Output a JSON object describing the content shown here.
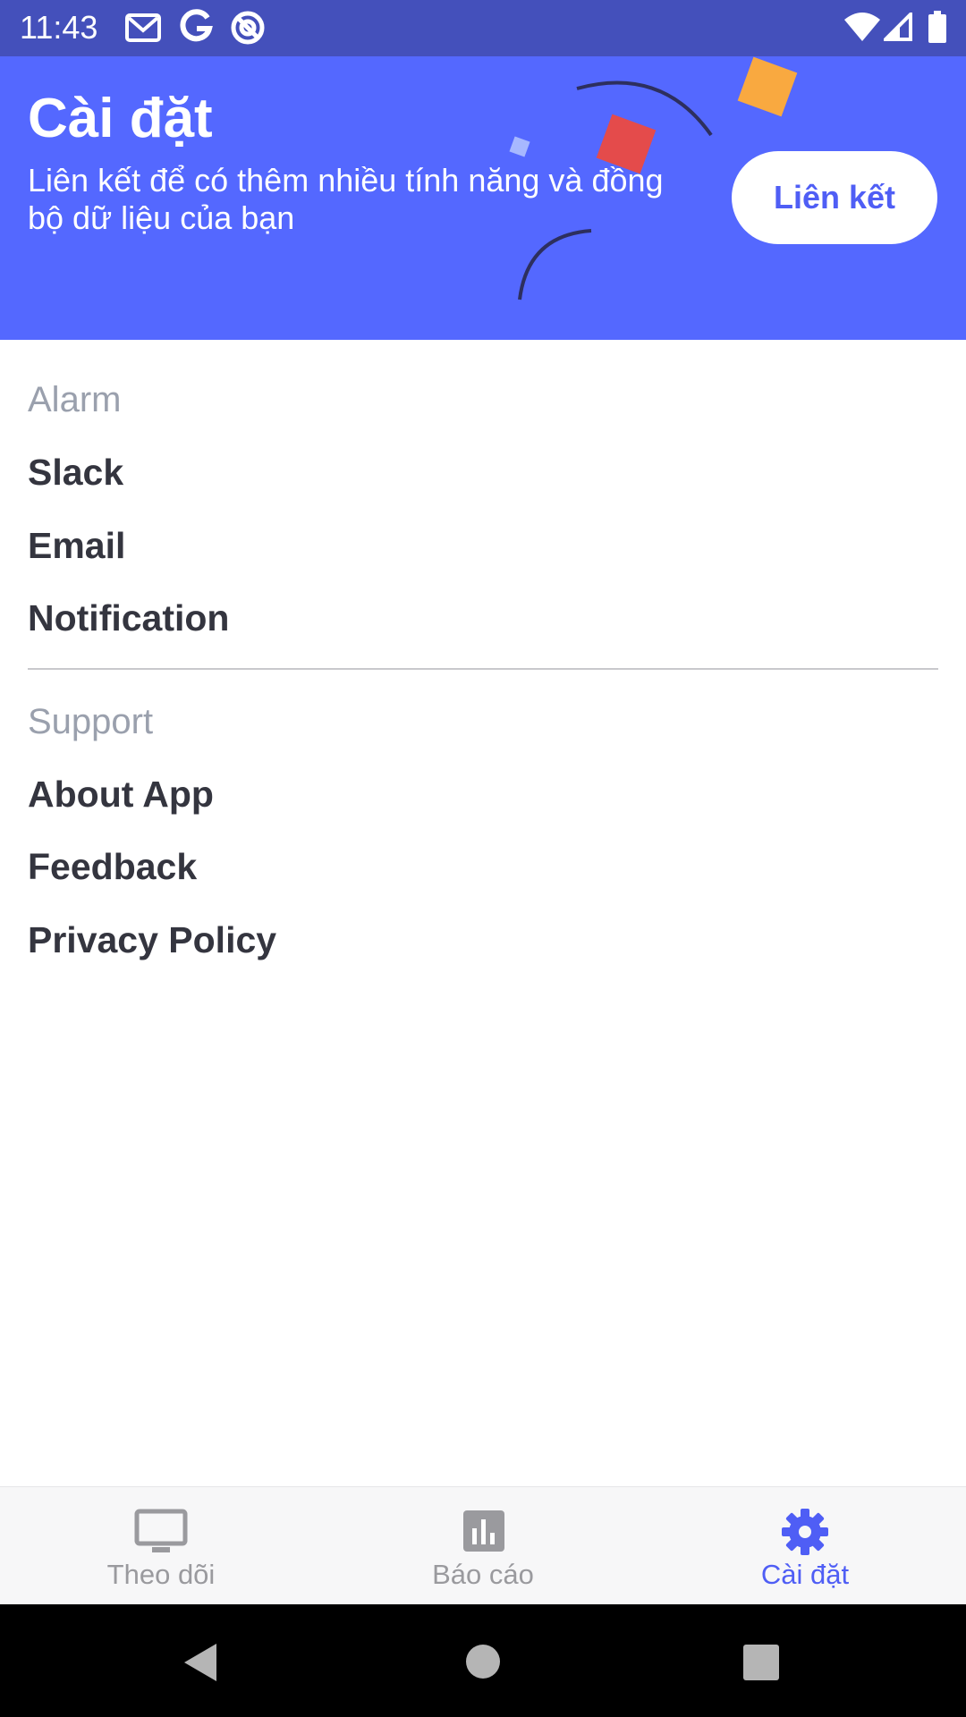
{
  "status_bar": {
    "time": "11:43",
    "left_icons": [
      "gmail-icon",
      "google-icon",
      "vpn-icon"
    ],
    "right_icons": [
      "wifi-icon",
      "signal-icon",
      "battery-icon"
    ]
  },
  "banner": {
    "title": "Cài đặt",
    "subtitle": "Liên kết để có thêm nhiều tính năng và đồng bộ dữ liệu của bạn",
    "link_button": "Liên kết",
    "background_color": "#5468ff",
    "accent_color": "#4f5ef5"
  },
  "sections": [
    {
      "header": "Alarm",
      "items": [
        "Slack",
        "Email",
        "Notification"
      ]
    },
    {
      "header": "Support",
      "items": [
        "About App",
        "Feedback",
        "Privacy Policy"
      ]
    }
  ],
  "bottom_nav": {
    "tabs": [
      {
        "label": "Theo dõi",
        "icon": "monitor-icon",
        "active": false
      },
      {
        "label": "Báo cáo",
        "icon": "bar-chart-icon",
        "active": false
      },
      {
        "label": "Cài đặt",
        "icon": "gear-icon",
        "active": true
      }
    ]
  },
  "system_nav": {
    "buttons": [
      "back-icon",
      "home-icon",
      "recents-icon"
    ]
  }
}
